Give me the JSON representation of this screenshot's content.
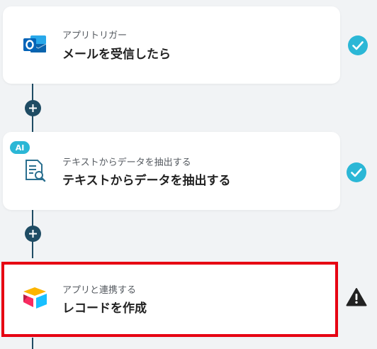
{
  "steps": [
    {
      "sub": "アプリトリガー",
      "main": "メールを受信したら",
      "icon": "outlook-icon",
      "status": "success"
    },
    {
      "badge": "AI",
      "sub": "テキストからデータを抽出する",
      "main": "テキストからデータを抽出する",
      "icon": "document-search-icon",
      "status": "success"
    },
    {
      "sub": "アプリと連携する",
      "main": "レコードを作成",
      "icon": "airtable-icon",
      "status": "warning"
    }
  ],
  "colors": {
    "background": "#f1f3f5",
    "connector": "#1f4c64",
    "success": "#2bb7d6",
    "warning": "#222222",
    "highlight": "#e60012",
    "ai_badge": "#2bb7d6"
  }
}
